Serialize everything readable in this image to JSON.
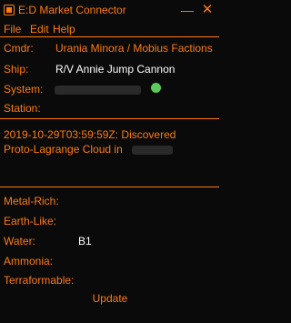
{
  "window": {
    "title": "E:D Market Connector",
    "minimize_glyph": "—",
    "close_glyph": "✕"
  },
  "menu": {
    "file": "File",
    "edit": "Edit",
    "help": "Help"
  },
  "info": {
    "cmdr_label": "Cmdr:",
    "cmdr_value": "Urania Minora / Mobius Factions",
    "ship_label": "Ship:",
    "ship_value": "R/V Annie Jump Cannon",
    "system_label": "System:",
    "station_label": "Station:"
  },
  "status": {
    "line1": "2019-10-29T03:59:59Z: Discovered",
    "line2": " Proto-Lagrange Cloud in"
  },
  "bodies": {
    "metal_rich_label": "Metal-Rich:",
    "earth_like_label": "Earth-Like:",
    "water_label": "Water:",
    "water_value": "B1",
    "ammonia_label": "Ammonia:",
    "terraformable_label": "Terraformable:"
  },
  "actions": {
    "update_label": "Update"
  },
  "colors": {
    "accent": "#ff7a12",
    "background": "#0a0a0a",
    "online_dot": "#5acb5a"
  },
  "icons": {
    "app": "app-icon",
    "online_indicator": "online-status-icon"
  }
}
